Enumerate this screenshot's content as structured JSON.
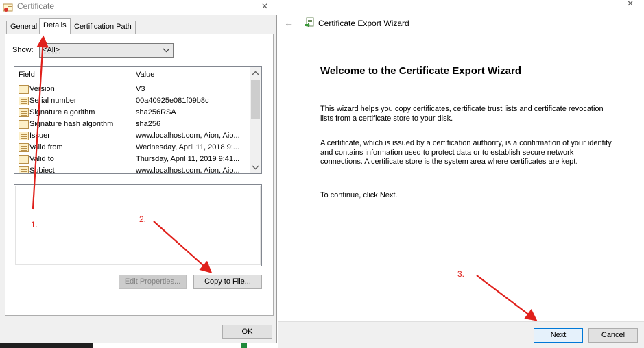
{
  "certificate_dialog": {
    "title": "Certificate",
    "tabs": [
      {
        "label": "General"
      },
      {
        "label": "Details"
      },
      {
        "label": "Certification Path"
      }
    ],
    "show_label": "Show:",
    "show_value": "<All>",
    "columns": {
      "field": "Field",
      "value": "Value"
    },
    "fields": [
      {
        "name": "Version",
        "value": "V3"
      },
      {
        "name": "Serial number",
        "value": "00a40925e081f09b8c"
      },
      {
        "name": "Signature algorithm",
        "value": "sha256RSA"
      },
      {
        "name": "Signature hash algorithm",
        "value": "sha256"
      },
      {
        "name": "Issuer",
        "value": "www.localhost.com, Aion, Aio..."
      },
      {
        "name": "Valid from",
        "value": "Wednesday, April 11, 2018 9:..."
      },
      {
        "name": "Valid to",
        "value": "Thursday, April 11, 2019 9:41..."
      },
      {
        "name": "Subject",
        "value": "www.localhost.com, Aion, Aio..."
      }
    ],
    "edit_properties_label": "Edit Properties...",
    "copy_to_file_label": "Copy to File...",
    "ok_label": "OK"
  },
  "export_wizard": {
    "title": "Certificate Export Wizard",
    "heading": "Welcome to the Certificate Export Wizard",
    "para1_line1": "This wizard helps you copy certificates, certificate trust lists and certificate revocation",
    "para1_line2": "lists from a certificate store to your disk.",
    "para2_line1": "A certificate, which is issued by a certification authority, is a confirmation of your identity",
    "para2_line2": "and contains information used to protect data or to establish secure network",
    "para2_line3": "connections. A certificate store is the system area where certificates are kept.",
    "para3": "To continue, click Next.",
    "next_label": "Next",
    "cancel_label": "Cancel"
  },
  "annotations": {
    "step1": "1.",
    "step2": "2.",
    "step3": "3.",
    "color": "#e0201b"
  },
  "icons": {
    "close": "×",
    "back": "←",
    "dropdown": "chevron-down",
    "scroll_up": "up-arrow",
    "scroll_down": "down-arrow"
  }
}
